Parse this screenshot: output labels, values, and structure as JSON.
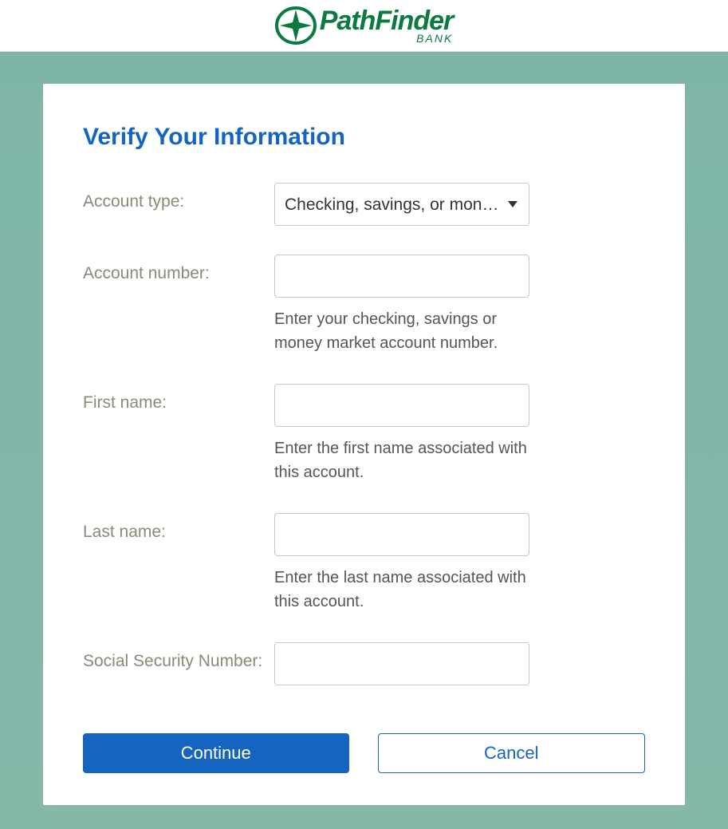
{
  "header": {
    "brand_name": "PathFinder",
    "brand_sub": "BANK"
  },
  "card": {
    "title": "Verify Your Information"
  },
  "form": {
    "account_type": {
      "label": "Account type:",
      "selected": "Checking, savings, or money market"
    },
    "account_number": {
      "label": "Account number:",
      "value": "",
      "help": "Enter your checking, savings or money market account number."
    },
    "first_name": {
      "label": "First name:",
      "value": "",
      "help": "Enter the first name associated with this account."
    },
    "last_name": {
      "label": "Last name:",
      "value": "",
      "help": "Enter the last name associated with this account."
    },
    "ssn": {
      "label": "Social Security Number:",
      "value": ""
    }
  },
  "buttons": {
    "continue": "Continue",
    "cancel": "Cancel"
  }
}
